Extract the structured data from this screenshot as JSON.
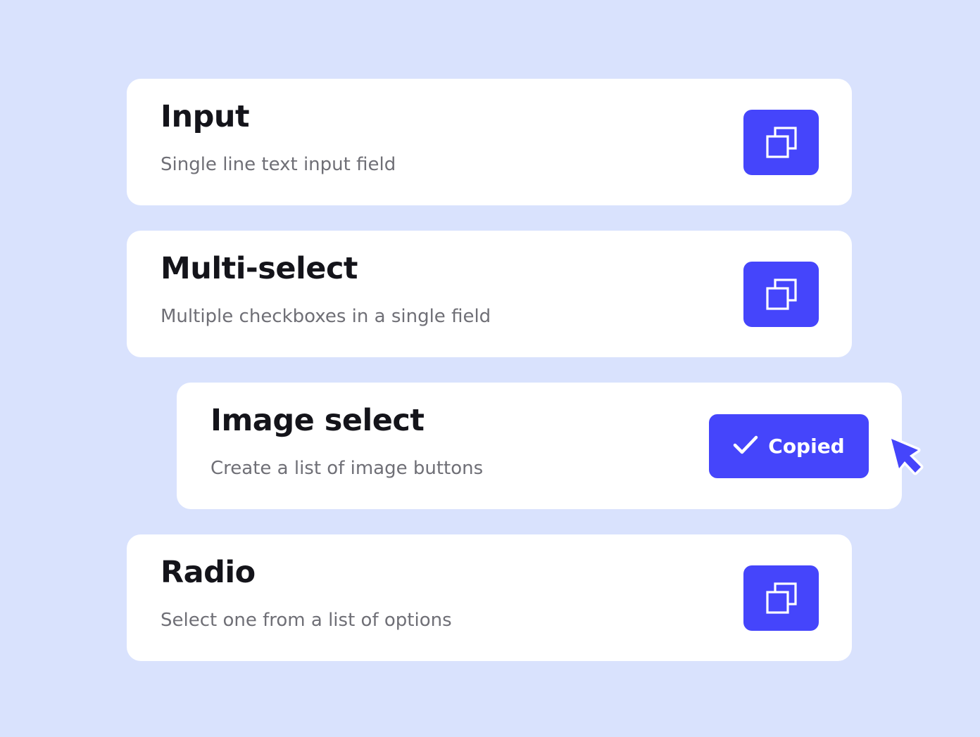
{
  "colors": {
    "background": "#d9e2fd",
    "card": "#ffffff",
    "accent": "#4545fb",
    "title": "#14141a",
    "description": "#6f6f76"
  },
  "fields": [
    {
      "title": "Input",
      "description": "Single line text input field",
      "button_icon": "copy-icon",
      "state": "default"
    },
    {
      "title": "Multi-select",
      "description": "Multiple checkboxes in a single field",
      "button_icon": "copy-icon",
      "state": "default"
    },
    {
      "title": "Image select",
      "description": "Create a list of image buttons",
      "button_icon": "checkmark-icon",
      "button_label": "Copied",
      "state": "copied"
    },
    {
      "title": "Radio",
      "description": "Select one from a list of options",
      "button_icon": "copy-icon",
      "state": "default"
    }
  ],
  "cursor_icon": "mouse-pointer-icon"
}
